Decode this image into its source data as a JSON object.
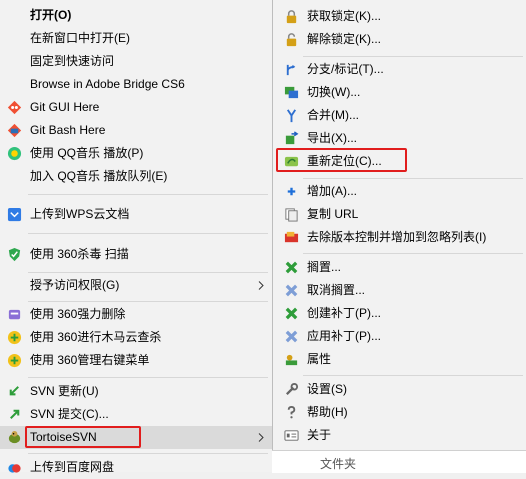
{
  "left_menu": {
    "items": [
      {
        "label": "打开(O)",
        "icon": "none"
      },
      {
        "label": "在新窗口中打开(E)",
        "icon": "none"
      },
      {
        "label": "固定到快速访问",
        "icon": "none"
      },
      {
        "label": "Browse in Adobe Bridge CS6",
        "icon": "none"
      },
      {
        "label": "Git GUI Here",
        "icon": "git-gui-icon"
      },
      {
        "label": "Git Bash Here",
        "icon": "git-bash-icon"
      },
      {
        "label": "使用 QQ音乐 播放(P)",
        "icon": "qq-music-icon"
      },
      {
        "label": "加入 QQ音乐 播放队列(E)",
        "icon": "none"
      },
      {
        "label": "上传到WPS云文档",
        "icon": "wps-cloud-icon"
      },
      {
        "label": "使用 360杀毒 扫描",
        "icon": "360-antivirus-icon"
      },
      {
        "label": "授予访问权限(G)",
        "icon": "none"
      },
      {
        "label": "使用 360强力删除",
        "icon": "360-shred-icon"
      },
      {
        "label": "使用 360进行木马云查杀",
        "icon": "360-trojan-icon"
      },
      {
        "label": "使用 360管理右键菜单",
        "icon": "360-menu-icon"
      },
      {
        "label": "SVN 更新(U)",
        "icon": "svn-update-icon"
      },
      {
        "label": "SVN 提交(C)...",
        "icon": "svn-commit-icon"
      },
      {
        "label": "TortoiseSVN",
        "icon": "tortoisesvn-icon"
      },
      {
        "label": "上传到百度网盘",
        "icon": "baidu-netdisk-icon"
      }
    ]
  },
  "right_menu": {
    "items": [
      {
        "label": "获取锁定(K)...",
        "icon": "lock-icon"
      },
      {
        "label": "解除锁定(K)...",
        "icon": "unlock-icon"
      },
      {
        "label": "分支/标记(T)...",
        "icon": "branch-icon"
      },
      {
        "label": "切换(W)...",
        "icon": "switch-icon"
      },
      {
        "label": "合并(M)...",
        "icon": "merge-icon"
      },
      {
        "label": "导出(X)...",
        "icon": "export-icon"
      },
      {
        "label": "重新定位(C)...",
        "icon": "relocate-icon"
      },
      {
        "label": "增加(A)...",
        "icon": "add-icon"
      },
      {
        "label": "复制 URL",
        "icon": "copy-url-icon"
      },
      {
        "label": "去除版本控制并增加到忽略列表(I)",
        "icon": "ignore-icon"
      },
      {
        "label": "搁置...",
        "icon": "shelve-icon"
      },
      {
        "label": "取消搁置...",
        "icon": "unshelve-icon"
      },
      {
        "label": "创建补丁(P)...",
        "icon": "create-patch-icon"
      },
      {
        "label": "应用补丁(P)...",
        "icon": "apply-patch-icon"
      },
      {
        "label": "属性",
        "icon": "properties-icon"
      },
      {
        "label": "设置(S)",
        "icon": "settings-icon"
      },
      {
        "label": "帮助(H)",
        "icon": "help-icon"
      },
      {
        "label": "关于",
        "icon": "about-icon"
      }
    ]
  },
  "status": {
    "column_header": "文件夹"
  },
  "colors": {
    "highlight_border": "#e11d1d",
    "menu_bg": "#f2f2f2",
    "hover_bg": "#dadada"
  }
}
